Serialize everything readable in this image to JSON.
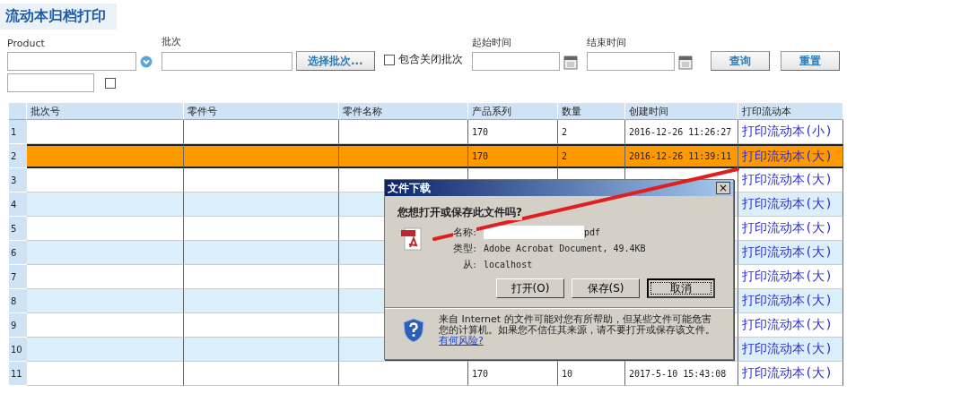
{
  "page_title": "流动本归档打印",
  "filters": {
    "product": {
      "label": "Product"
    },
    "batch": {
      "label": "批次",
      "button": "选择批次..."
    },
    "include_closed": {
      "label": "包含关闭批次",
      "checked": false
    },
    "start_time": {
      "label": "起始时间"
    },
    "end_time": {
      "label": "结束时间"
    },
    "buttons": [
      "查询",
      "重置"
    ],
    "extra_checkbox": {
      "checked": false
    }
  },
  "table": {
    "columns": [
      "批次号",
      "零件号",
      "零件名称",
      "产品系列",
      "数量",
      "创建时间",
      "打印流动本"
    ],
    "rows": [
      {
        "number": "1",
        "series": "170",
        "quantity": "2",
        "created": "2016-12-26 11:26:27",
        "print_link": "打印流动本(小)",
        "selected": false
      },
      {
        "number": "2",
        "series": "170",
        "quantity": "2",
        "created": "2016-12-26 11:39:11",
        "print_link": "打印流动本(大)",
        "selected": true
      },
      {
        "number": "3",
        "print_link": "打印流动本(大)",
        "selected": false
      },
      {
        "number": "4",
        "print_link": "打印流动本(大)",
        "selected": false
      },
      {
        "number": "5",
        "print_link": "打印流动本(大)",
        "selected": false
      },
      {
        "number": "6",
        "print_link": "打印流动本(大)",
        "selected": false
      },
      {
        "number": "7",
        "print_link": "打印流动本(大)",
        "selected": false
      },
      {
        "number": "8",
        "print_link": "打印流动本(大)",
        "selected": false
      },
      {
        "number": "9",
        "print_link": "打印流动本(大)",
        "selected": false
      },
      {
        "number": "10",
        "print_link": "打印流动本(大)",
        "selected": false
      },
      {
        "number": "11",
        "series": "170",
        "quantity": "10",
        "created": "2017-5-10 15:43:08",
        "print_link": "打印流动本(大)",
        "selected": false
      }
    ]
  },
  "dialog": {
    "title": "文件下载",
    "close": "×",
    "question": "您想打开或保存此文件吗?",
    "fields": [
      {
        "label": "名称:",
        "value": "pdf",
        "redacted": true
      },
      {
        "label": "类型:",
        "value": "Adobe Acrobat Document, 49.4KB",
        "redacted": false
      },
      {
        "label": "从:",
        "value": "localhost",
        "redacted": false
      }
    ],
    "buttons": [
      {
        "label": "打开(O)",
        "default": false
      },
      {
        "label": "保存(S)",
        "default": false
      },
      {
        "label": "取消",
        "default": true
      }
    ],
    "warning": "来自 Internet 的文件可能对您有所帮助，但某些文件可能危害您的计算机。如果您不信任其来源，请不要打开或保存该文件。",
    "warning_link": "有何风险?"
  }
}
